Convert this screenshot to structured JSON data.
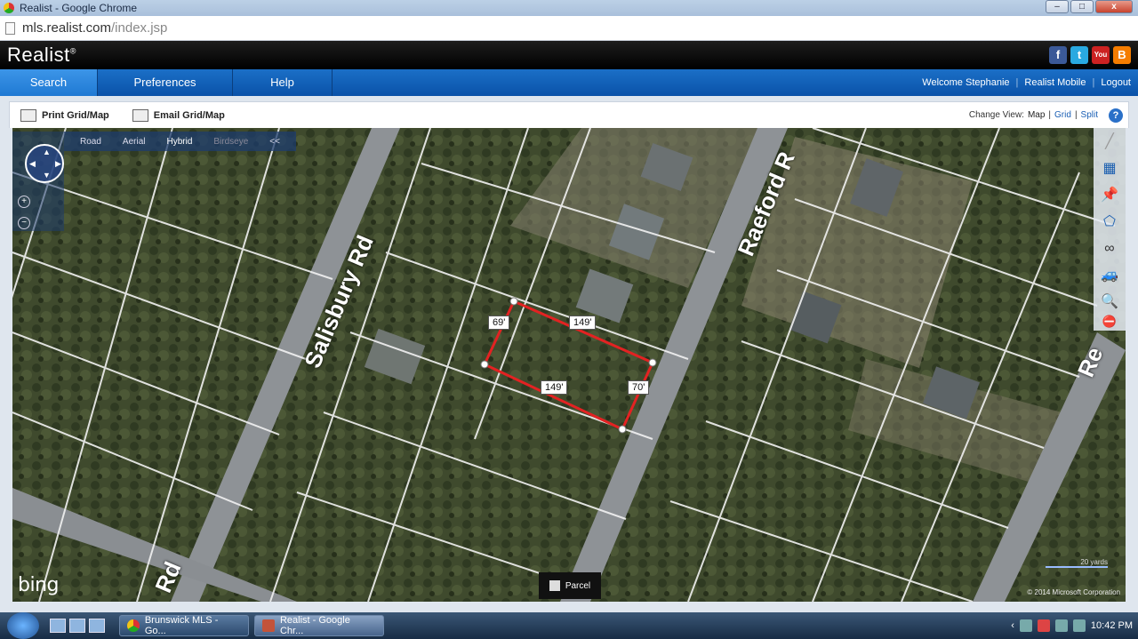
{
  "browser": {
    "window_title": "Realist - Google Chrome",
    "url_host": "mls.realist.com",
    "url_path": "/index.jsp"
  },
  "app": {
    "brand": "Realist",
    "brand_mark": "®",
    "social": [
      {
        "icon": "facebook-icon",
        "glyph": "f",
        "color": "#3b5998"
      },
      {
        "icon": "twitter-icon",
        "glyph": "t",
        "color": "#29a9e1"
      },
      {
        "icon": "youtube-icon",
        "glyph": "You",
        "color": "#cc2222"
      },
      {
        "icon": "blogger-icon",
        "glyph": "B",
        "color": "#f57d00"
      }
    ]
  },
  "nav": {
    "tabs": [
      {
        "label": "Search",
        "active": true
      },
      {
        "label": "Preferences",
        "active": false
      },
      {
        "label": "Help",
        "active": false
      }
    ],
    "welcome": "Welcome Stephanie",
    "mobile": "Realist Mobile",
    "logout": "Logout"
  },
  "toolbar": {
    "print": "Print Grid/Map",
    "email": "Email Grid/Map",
    "change_view": "Change View:",
    "view_map": "Map",
    "view_grid": "Grid",
    "view_split": "Split",
    "help_glyph": "?"
  },
  "map": {
    "types": [
      "Road",
      "Aerial",
      "Hybrid",
      "Birdseye"
    ],
    "active_type": "Hybrid",
    "collapse": "<<",
    "streets": [
      "Salisbury Rd",
      "Raeford R",
      "Rd",
      "Re"
    ],
    "dimensions": [
      "69'",
      "149'",
      "149'",
      "70'"
    ],
    "parcel_label": "Parcel",
    "bing": "bing",
    "copyright": "© 2014 Microsoft Corporation",
    "scale": "20 yards",
    "zoom_in": "+",
    "zoom_out": "−"
  },
  "taskbar": {
    "tasks": [
      "Brunswick MLS - Go...",
      "Realist - Google Chr..."
    ],
    "clock": "10:42 PM"
  }
}
